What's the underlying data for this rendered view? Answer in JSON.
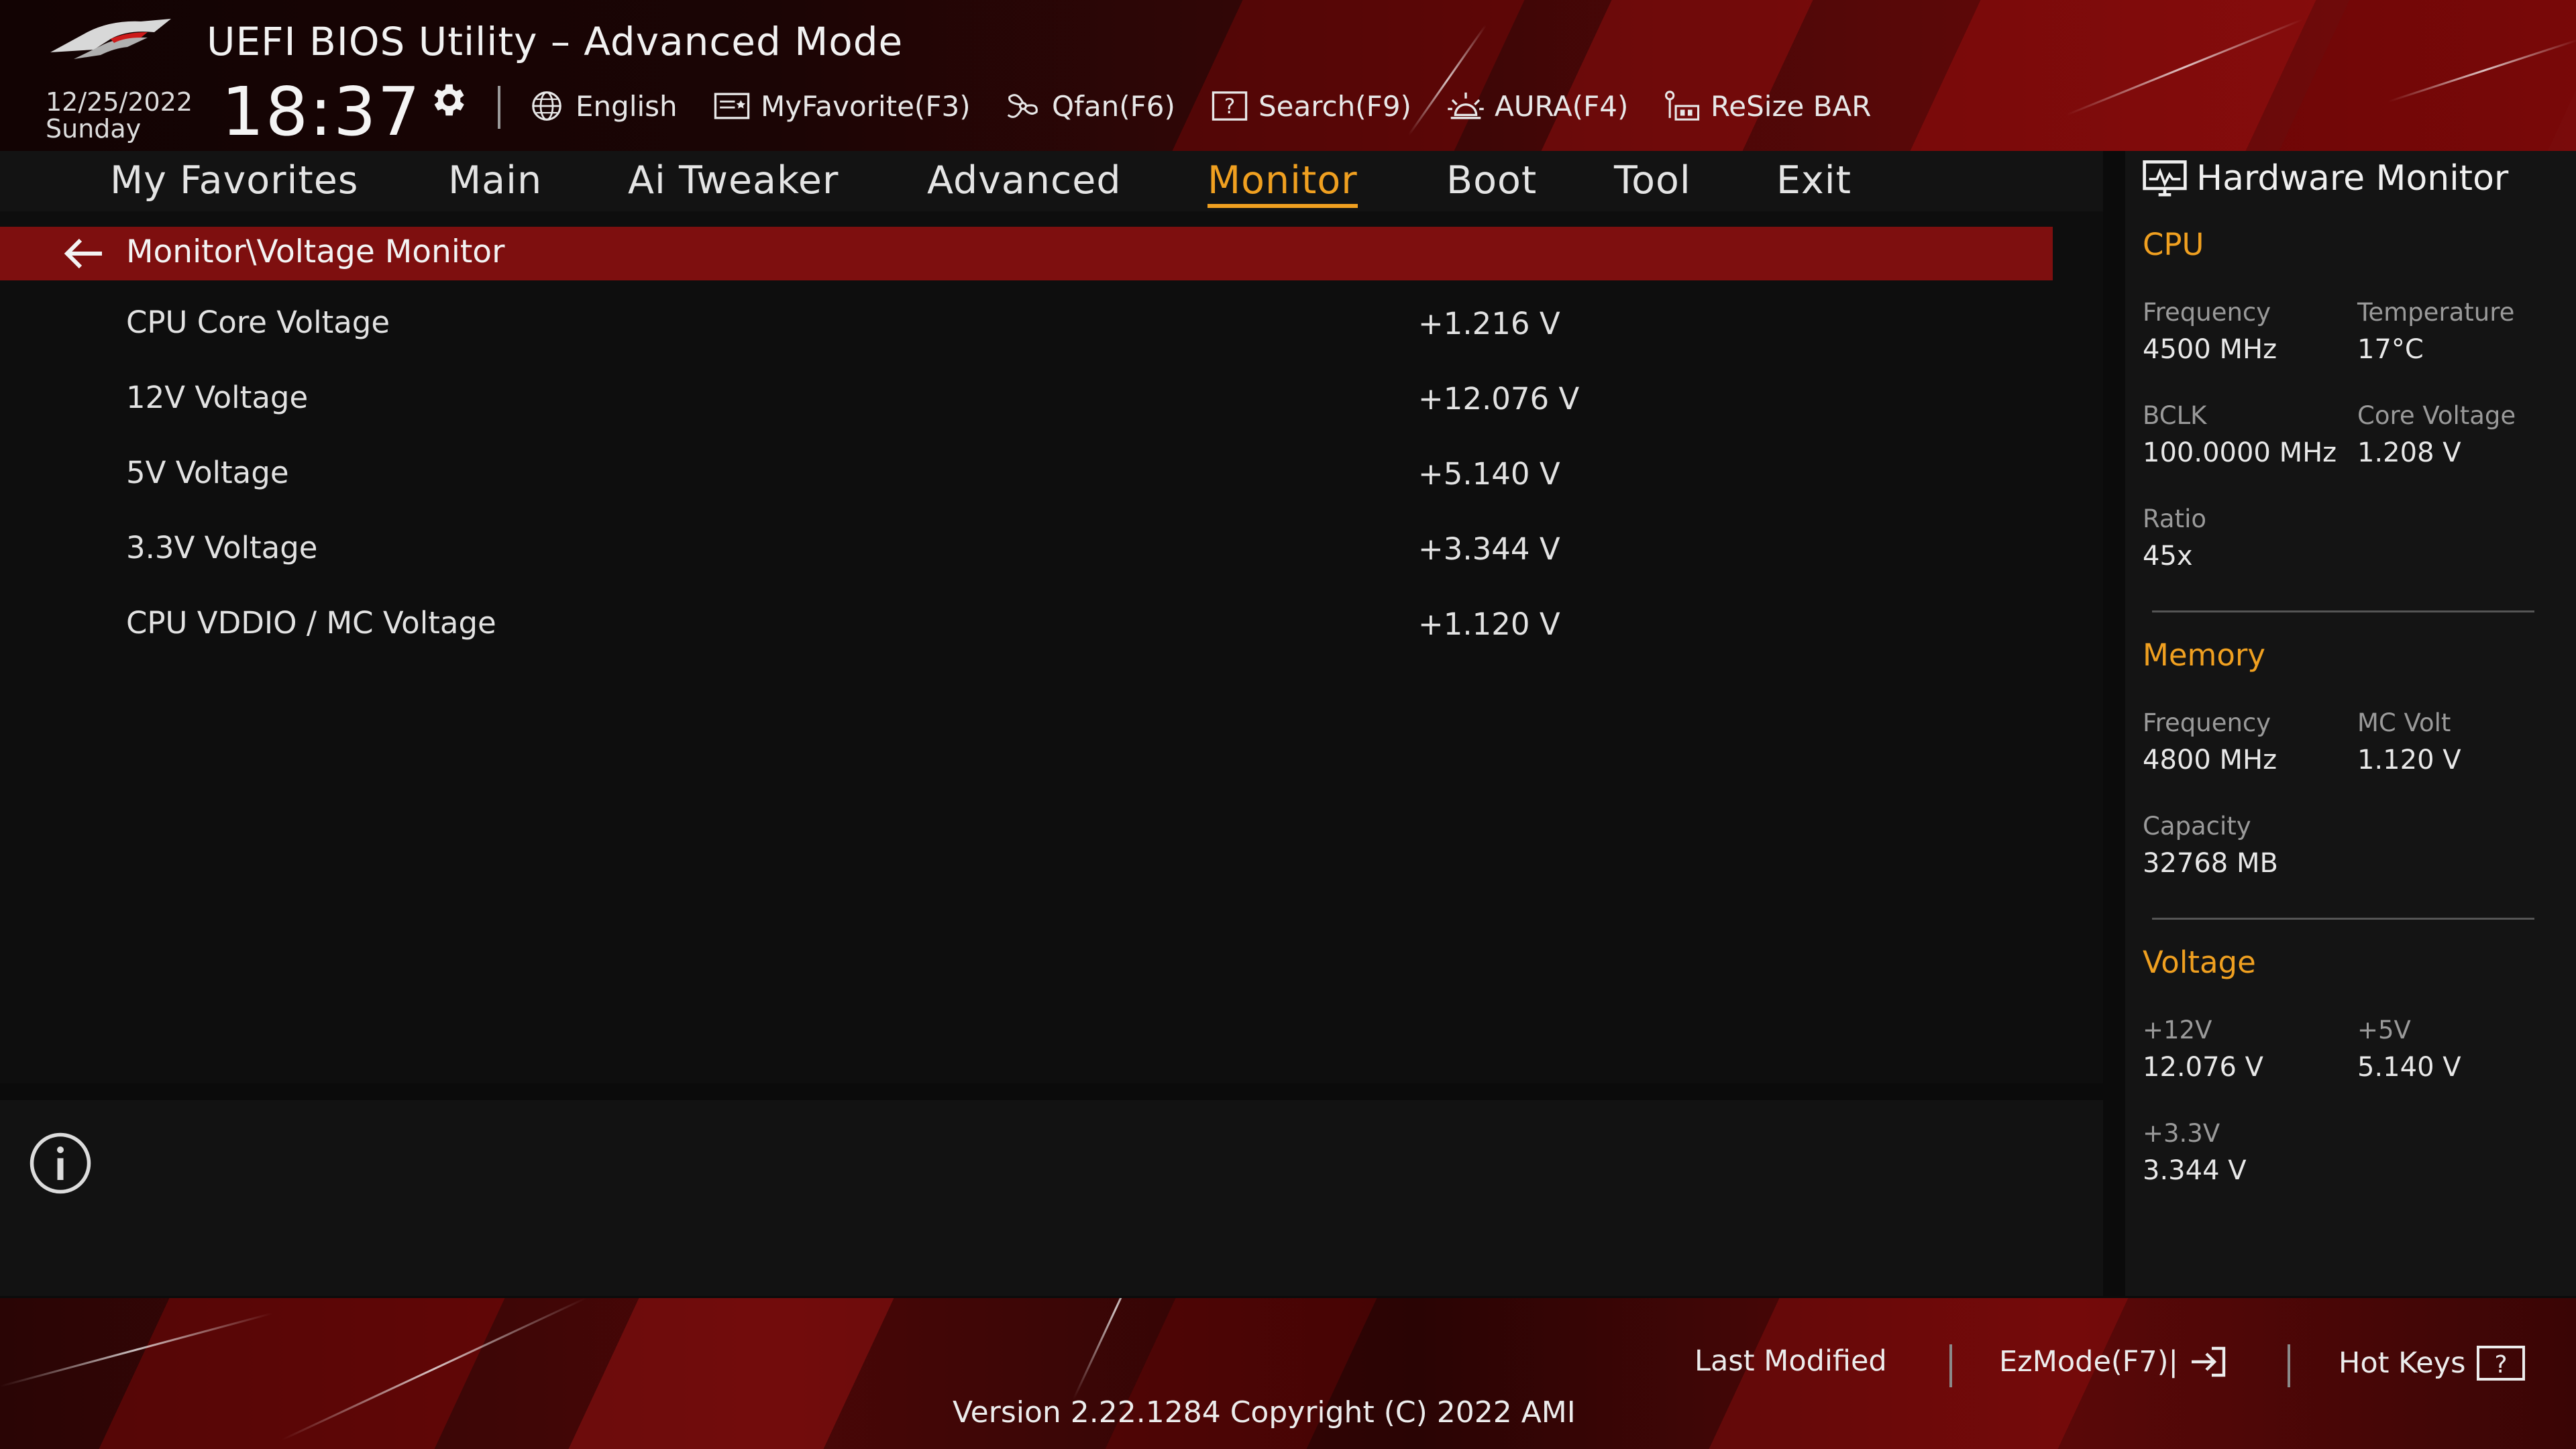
{
  "header": {
    "title": "UEFI BIOS Utility – Advanced Mode",
    "date": "12/25/2022",
    "day": "Sunday",
    "time": "18:37"
  },
  "toolbar": {
    "items": [
      {
        "label": "English",
        "icon": "globe-icon"
      },
      {
        "label": "MyFavorite(F3)",
        "icon": "favorite-icon"
      },
      {
        "label": "Qfan(F6)",
        "icon": "fan-icon"
      },
      {
        "label": "Search(F9)",
        "icon": "search-icon"
      },
      {
        "label": "AURA(F4)",
        "icon": "aura-icon"
      },
      {
        "label": "ReSize BAR",
        "icon": "resize-bar-icon"
      }
    ]
  },
  "nav": {
    "tabs": [
      {
        "label": "My Favorites"
      },
      {
        "label": "Main"
      },
      {
        "label": "Ai Tweaker"
      },
      {
        "label": "Advanced"
      },
      {
        "label": "Monitor",
        "active": true
      },
      {
        "label": "Boot"
      },
      {
        "label": "Tool"
      },
      {
        "label": "Exit"
      }
    ]
  },
  "main": {
    "breadcrumb": "Monitor\\Voltage Monitor",
    "rows": [
      {
        "label": "CPU Core Voltage",
        "value": "+1.216 V"
      },
      {
        "label": "12V Voltage",
        "value": "+12.076 V"
      },
      {
        "label": "5V Voltage",
        "value": "+5.140 V"
      },
      {
        "label": "3.3V Voltage",
        "value": "+3.344 V"
      },
      {
        "label": "CPU VDDIO / MC Voltage",
        "value": "+1.120 V"
      }
    ]
  },
  "hardware_monitor": {
    "title": "Hardware Monitor",
    "cpu": {
      "heading": "CPU",
      "frequency_label": "Frequency",
      "frequency": "4500 MHz",
      "temperature_label": "Temperature",
      "temperature": "17°C",
      "bclk_label": "BCLK",
      "bclk": "100.0000 MHz",
      "core_voltage_label": "Core Voltage",
      "core_voltage": "1.208 V",
      "ratio_label": "Ratio",
      "ratio": "45x"
    },
    "memory": {
      "heading": "Memory",
      "frequency_label": "Frequency",
      "frequency": "4800 MHz",
      "mc_volt_label": "MC Volt",
      "mc_volt": "1.120 V",
      "capacity_label": "Capacity",
      "capacity": "32768 MB"
    },
    "voltage": {
      "heading": "Voltage",
      "v12_label": "+12V",
      "v12": "12.076 V",
      "v5_label": "+5V",
      "v5": "5.140 V",
      "v33_label": "+3.3V",
      "v33": "3.344 V"
    }
  },
  "footer": {
    "last_modified": "Last Modified",
    "ezmode": "EzMode(F7)|",
    "hotkeys": "Hot Keys",
    "version": "Version 2.22.1284 Copyright (C) 2022 AMI"
  },
  "colors": {
    "accent": "#f0a020",
    "selection_bar": "#7e0f0f"
  }
}
